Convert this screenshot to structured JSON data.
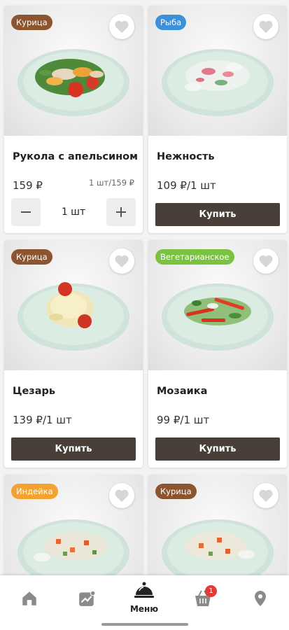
{
  "colors": {
    "badge_chicken": "#8c5530",
    "badge_fish": "#3d8fd8",
    "badge_veg": "#7cc241",
    "badge_turkey": "#f2a22e",
    "button_dark": "#4a3f38",
    "cart_badge": "#e53935"
  },
  "cards": [
    {
      "badge": "Курица",
      "badge_color": "#8c5530",
      "title": "Рукола с апельсином",
      "price": "159 ₽",
      "unit_price": "1 шт/159 ₽",
      "quantity": "1 шт",
      "minus_icon": "minus-icon",
      "plus_icon": "plus-icon"
    },
    {
      "badge": "Рыба",
      "badge_color": "#3d8fd8",
      "title": "Нежность",
      "price": "109 ₽/1 шт",
      "buy_label": "Купить"
    },
    {
      "badge": "Курица",
      "badge_color": "#8c5530",
      "title": "Цезарь",
      "price": "139 ₽/1 шт",
      "buy_label": "Купить"
    },
    {
      "badge": "Вегетарианское",
      "badge_color": "#7cc241",
      "title": "Мозаика",
      "price": "99 ₽/1 шт",
      "buy_label": "Купить"
    },
    {
      "badge": "Индейка",
      "badge_color": "#f2a22e"
    },
    {
      "badge": "Курица",
      "badge_color": "#8c5530"
    }
  ],
  "navbar": {
    "items": [
      {
        "icon": "home-icon"
      },
      {
        "icon": "trending-icon"
      },
      {
        "icon": "menu-cloche-icon",
        "label": "Меню"
      },
      {
        "icon": "cart-icon",
        "badge": "1"
      },
      {
        "icon": "location-icon"
      }
    ]
  }
}
